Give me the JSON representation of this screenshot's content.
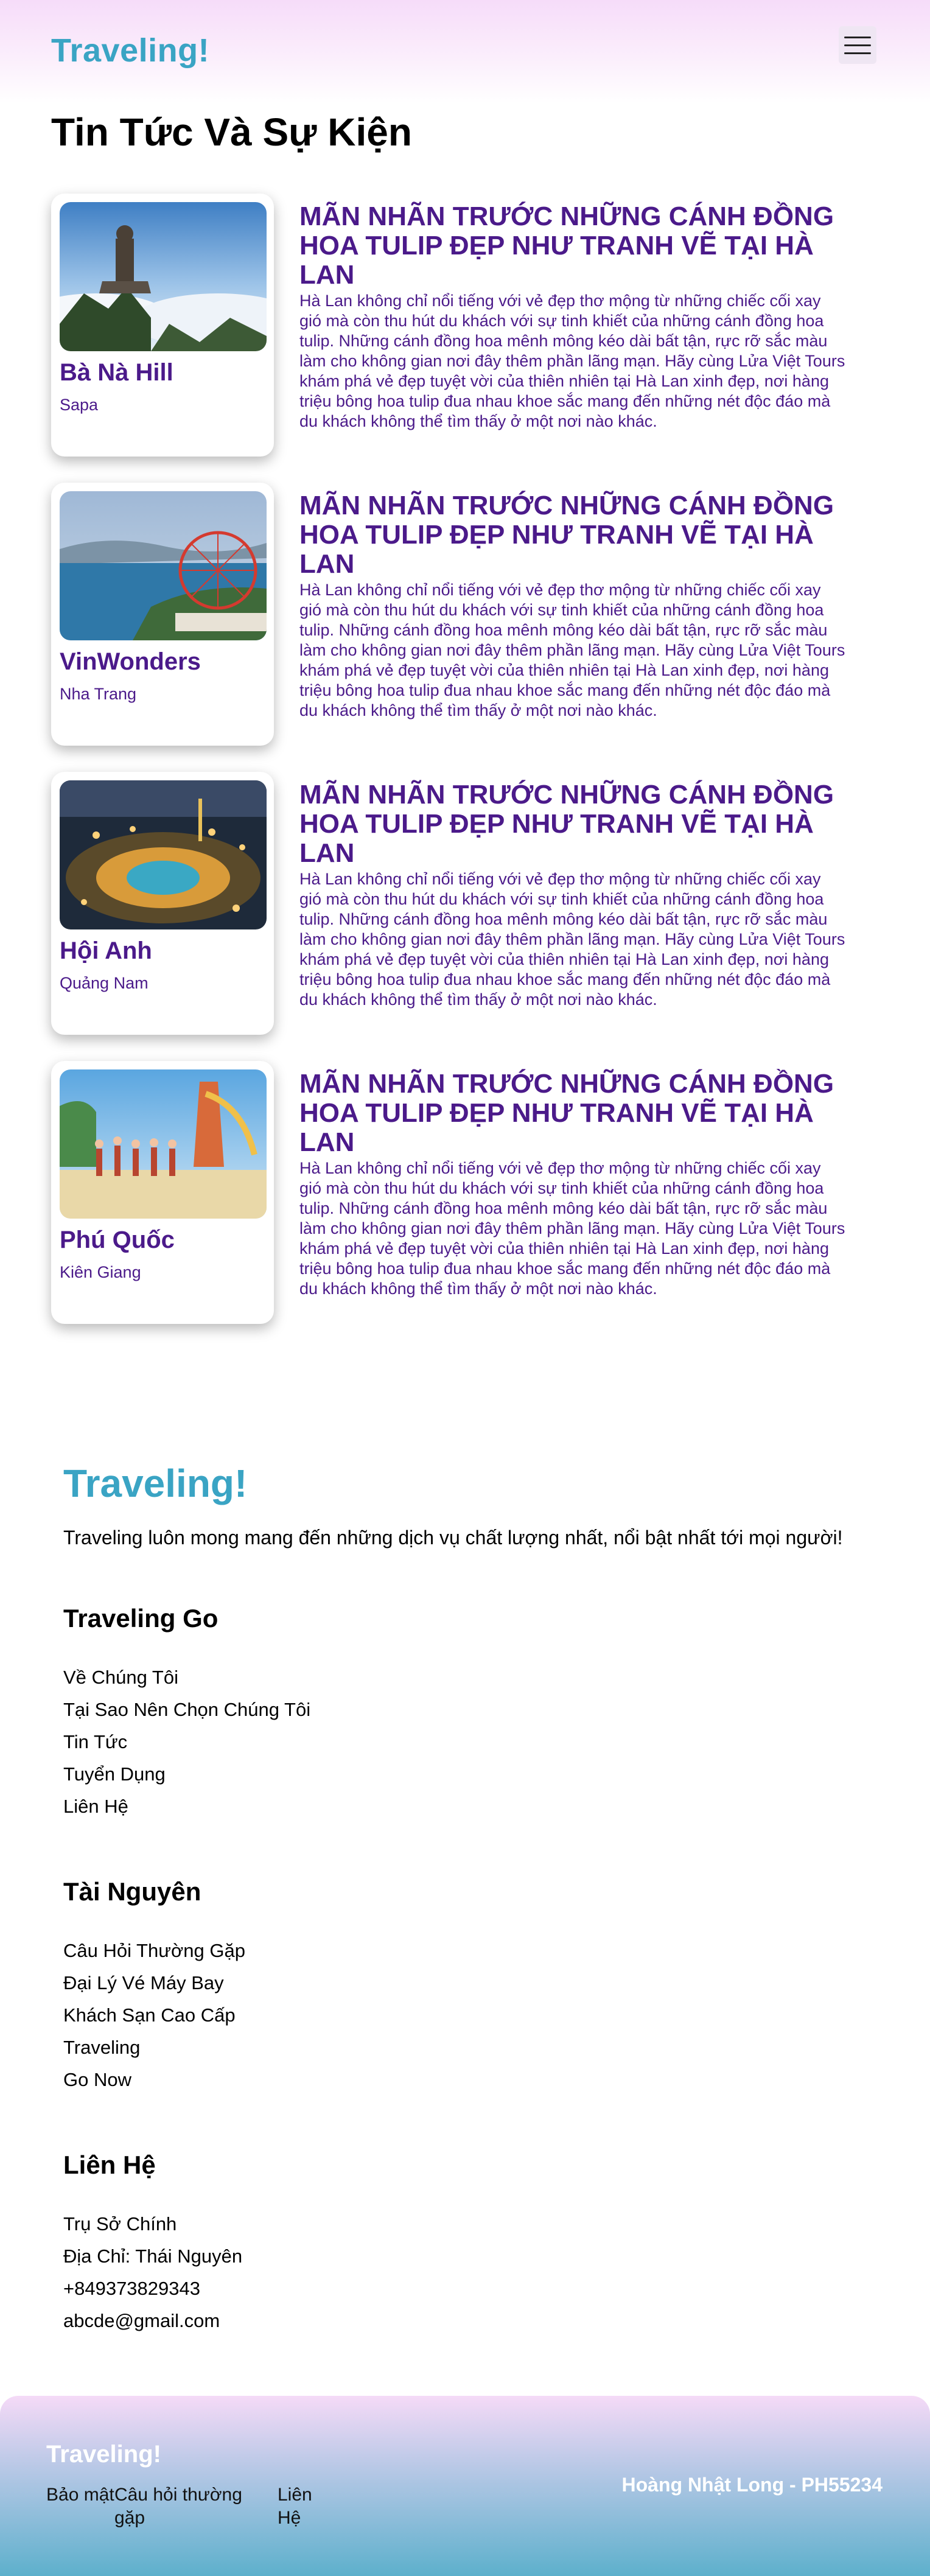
{
  "header": {
    "brand": "Traveling!",
    "menu_icon": "hamburger-icon"
  },
  "page_title": "Tin Tức Và Sự Kiện",
  "news": [
    {
      "name": "Bà Nà Hill",
      "location": "Sapa",
      "title": "MÃN NHÃN TRƯỚC NHỮNG CÁNH ĐỒNG HOA TULIP ĐẸP NHƯ TRANH VẼ TẠI HÀ LAN",
      "body": "Hà Lan không chỉ nổi tiếng với vẻ đẹp thơ mộng từ những chiếc cối xay gió mà còn thu hút du khách với sự tinh khiết của những cánh đồng hoa tulip. Những cánh đồng hoa mênh mông kéo dài bất tận, rực rỡ sắc màu làm cho không gian nơi đây thêm phần lãng mạn. Hãy cùng Lửa Việt Tours khám phá vẻ đẹp tuyệt vời của thiên nhiên tại Hà Lan xinh đẹp, nơi hàng triệu bông hoa tulip đua nhau khoe sắc mang đến những nét độc đáo mà du khách không thể tìm thấy ở một nơi nào khác."
    },
    {
      "name": "VinWonders",
      "location": "Nha Trang",
      "title": "MÃN NHÃN TRƯỚC NHỮNG CÁNH ĐỒNG HOA TULIP ĐẸP NHƯ TRANH VẼ TẠI HÀ LAN",
      "body": "Hà Lan không chỉ nổi tiếng với vẻ đẹp thơ mộng từ những chiếc cối xay gió mà còn thu hút du khách với sự tinh khiết của những cánh đồng hoa tulip. Những cánh đồng hoa mênh mông kéo dài bất tận, rực rỡ sắc màu làm cho không gian nơi đây thêm phần lãng mạn. Hãy cùng Lửa Việt Tours khám phá vẻ đẹp tuyệt vời của thiên nhiên tại Hà Lan xinh đẹp, nơi hàng triệu bông hoa tulip đua nhau khoe sắc mang đến những nét độc đáo mà du khách không thể tìm thấy ở một nơi nào khác."
    },
    {
      "name": "Hội Anh",
      "location": "Quảng Nam",
      "title": "MÃN NHÃN TRƯỚC NHỮNG CÁNH ĐỒNG HOA TULIP ĐẸP NHƯ TRANH VẼ TẠI HÀ LAN",
      "body": "Hà Lan không chỉ nổi tiếng với vẻ đẹp thơ mộng từ những chiếc cối xay gió mà còn thu hút du khách với sự tinh khiết của những cánh đồng hoa tulip. Những cánh đồng hoa mênh mông kéo dài bất tận, rực rỡ sắc màu làm cho không gian nơi đây thêm phần lãng mạn. Hãy cùng Lửa Việt Tours khám phá vẻ đẹp tuyệt vời của thiên nhiên tại Hà Lan xinh đẹp, nơi hàng triệu bông hoa tulip đua nhau khoe sắc mang đến những nét độc đáo mà du khách không thể tìm thấy ở một nơi nào khác."
    },
    {
      "name": "Phú Quốc",
      "location": "Kiên Giang",
      "title": "MÃN NHÃN TRƯỚC NHỮNG CÁNH ĐỒNG HOA TULIP ĐẸP NHƯ TRANH VẼ TẠI HÀ LAN",
      "body": "Hà Lan không chỉ nổi tiếng với vẻ đẹp thơ mộng từ những chiếc cối xay gió mà còn thu hút du khách với sự tinh khiết của những cánh đồng hoa tulip. Những cánh đồng hoa mênh mông kéo dài bất tận, rực rỡ sắc màu làm cho không gian nơi đây thêm phần lãng mạn. Hãy cùng Lửa Việt Tours khám phá vẻ đẹp tuyệt vời của thiên nhiên tại Hà Lan xinh đẹp, nơi hàng triệu bông hoa tulip đua nhau khoe sắc mang đến những nét độc đáo mà du khách không thể tìm thấy ở một nơi nào khác."
    }
  ],
  "info": {
    "brand": "Traveling!",
    "tagline": "Traveling luôn mong mang đến những dịch vụ chất lượng nhất, nổi bật nhất tới mọi người!",
    "columns": [
      {
        "heading": "Traveling Go",
        "items": [
          "Về Chúng Tôi",
          "Tại Sao Nên Chọn Chúng Tôi",
          "Tin Tức",
          "Tuyển Dụng",
          "Liên Hệ"
        ]
      },
      {
        "heading": "Tài Nguyên",
        "items": [
          "Câu Hỏi Thường Gặp",
          "Đại Lý Vé Máy Bay",
          "Khách Sạn Cao Cấp",
          "Traveling",
          "Go Now"
        ]
      },
      {
        "heading": "Liên Hệ",
        "items": [
          "Trụ Sở Chính",
          "Địa Chỉ: Thái Nguyên",
          "+849373829343",
          "abcde@gmail.com"
        ]
      }
    ]
  },
  "bottom_bar": {
    "brand": "Traveling!",
    "links": [
      "Bảo mật",
      "Câu hỏi thường gặp",
      "Liên Hệ"
    ],
    "author": "Hoàng Nhật Long - PH55234"
  },
  "colors": {
    "accent": "#3aa4c4",
    "purple_text": "#4b1a8a"
  }
}
